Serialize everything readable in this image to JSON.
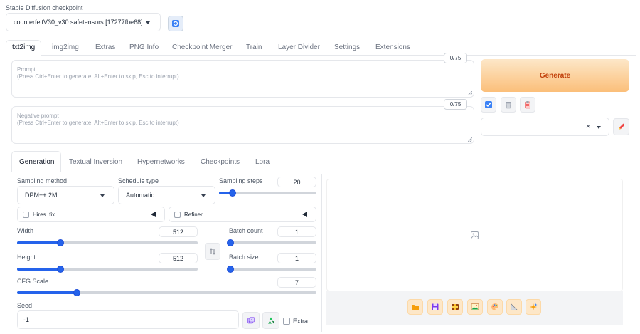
{
  "checkpoint": {
    "label": "Stable Diffusion checkpoint",
    "value": "counterfeitV30_v30.safetensors [17277fbe68]"
  },
  "main_tabs": [
    "txt2img",
    "img2img",
    "Extras",
    "PNG Info",
    "Checkpoint Merger",
    "Train",
    "Layer Divider",
    "Settings",
    "Extensions"
  ],
  "prompt": {
    "label": "Prompt",
    "placeholder": "(Press Ctrl+Enter to generate, Alt+Enter to skip, Esc to interrupt)",
    "counter": "0/75"
  },
  "negative_prompt": {
    "label": "Negative prompt",
    "placeholder": "(Press Ctrl+Enter to generate, Alt+Enter to skip, Esc to interrupt)",
    "counter": "0/75"
  },
  "generate_label": "Generate",
  "style_clear": "×",
  "sub_tabs": [
    "Generation",
    "Textual Inversion",
    "Hypernetworks",
    "Checkpoints",
    "Lora"
  ],
  "sampling_method": {
    "label": "Sampling method",
    "value": "DPM++ 2M"
  },
  "schedule_type": {
    "label": "Schedule type",
    "value": "Automatic"
  },
  "sampling_steps": {
    "label": "Sampling steps",
    "value": "20",
    "fraction": 0.14
  },
  "hires_fix": {
    "label": "Hires. fix"
  },
  "refiner": {
    "label": "Refiner"
  },
  "width": {
    "label": "Width",
    "value": "512",
    "fraction": 0.24
  },
  "height": {
    "label": "Height",
    "value": "512",
    "fraction": 0.24
  },
  "batch_count": {
    "label": "Batch count",
    "value": "1",
    "fraction": 0.02
  },
  "batch_size": {
    "label": "Batch size",
    "value": "1",
    "fraction": 0.02
  },
  "cfg_scale": {
    "label": "CFG Scale",
    "value": "7",
    "fraction": 0.2
  },
  "seed": {
    "label": "Seed",
    "value": "-1"
  },
  "extra_label": "Extra",
  "colors": {
    "accent": "#2563eb",
    "generate_from": "#fde7c8",
    "generate_to": "#fbbf7a",
    "generate_text": "#c2410c"
  },
  "output_tools": [
    "folder-icon",
    "save-icon",
    "zip-icon",
    "image-send-icon",
    "palette-icon",
    "ruler-icon",
    "sparkle-icon"
  ]
}
